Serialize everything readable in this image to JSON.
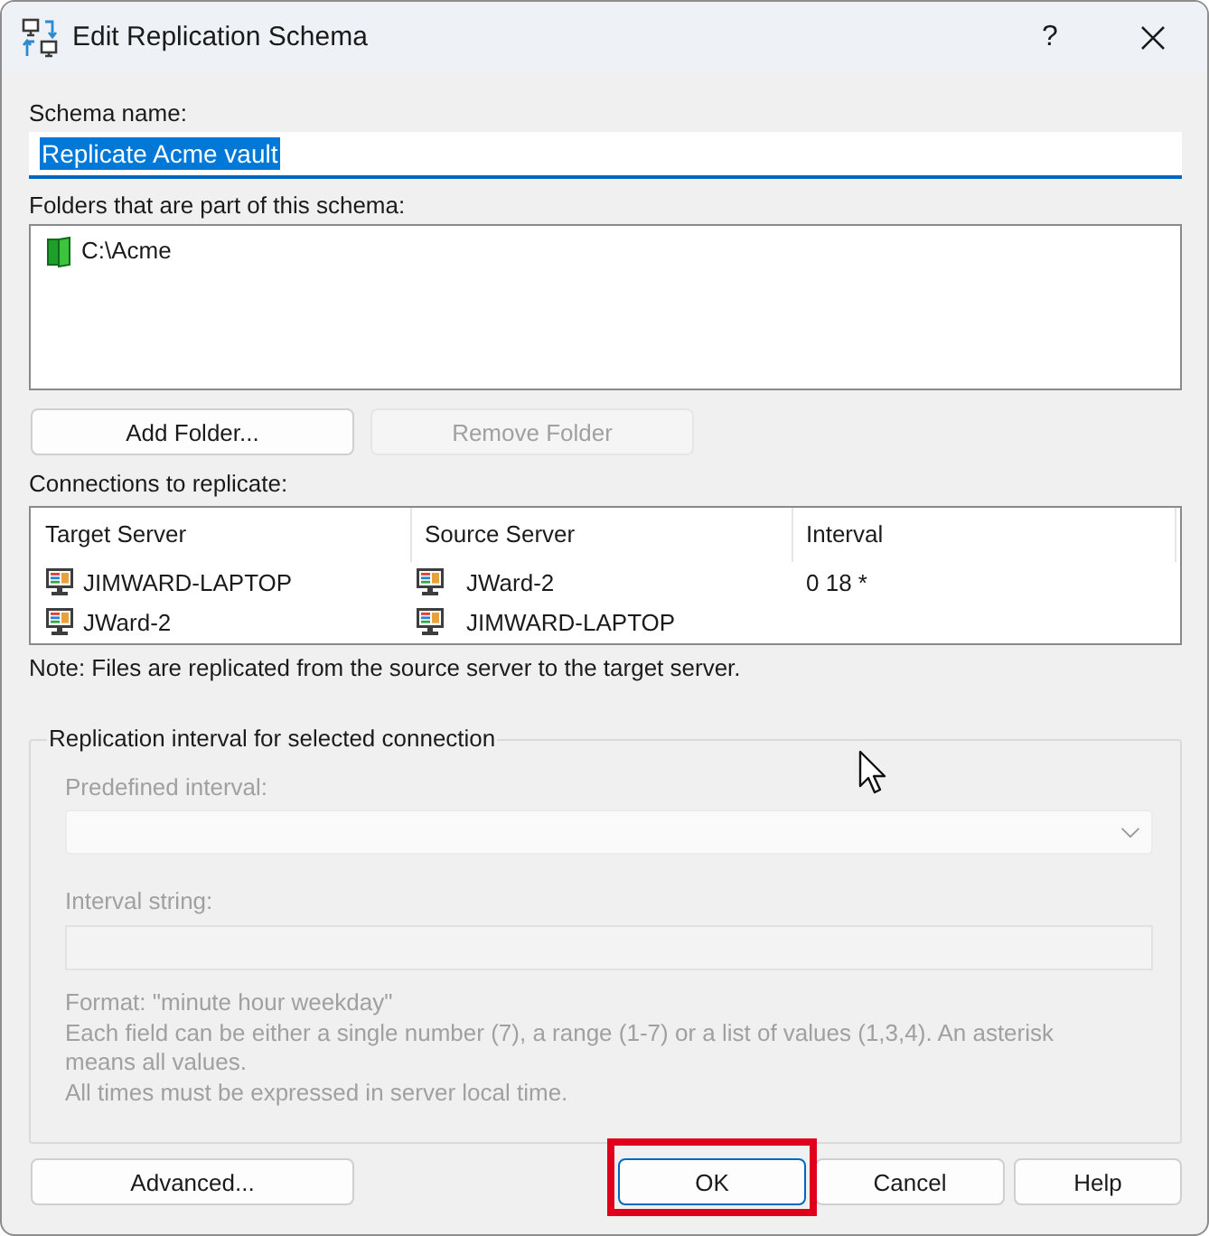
{
  "window": {
    "title": "Edit Replication Schema",
    "help_button": "?"
  },
  "schema_name": {
    "label": "Schema name:",
    "value": "Replicate Acme vault",
    "text_selected": true
  },
  "folders": {
    "label": "Folders that are part of this schema:",
    "items": [
      {
        "path": "C:\\Acme",
        "selected": false
      }
    ]
  },
  "folder_buttons": [
    {
      "label": "Add Folder...",
      "disabled": false
    },
    {
      "label": "Remove Folder",
      "disabled": true
    }
  ],
  "connections": {
    "label": "Connections to replicate:",
    "columns": [
      "Target Server",
      "Source Server",
      "Interval"
    ],
    "rows": [
      {
        "target": "JIMWARD-LAPTOP",
        "source": "JWard-2",
        "interval": "0 18 *",
        "selected": false
      },
      {
        "target": "JWard-2",
        "source": "JIMWARD-LAPTOP",
        "selected": false
      }
    ]
  },
  "note": "Note: Files are replicated from the source server to the target server.",
  "interval_group": {
    "title": "Replication interval for selected connection",
    "disabled": true,
    "predefined_label": "Predefined interval:",
    "interval_label": "Interval string:",
    "help_lines": [
      "Format: \"minute hour weekday\"",
      "Each field can be either a single number (7), a range (1-7) or a list of values (1,3,4). An asterisk means all values.",
      "All times must be expressed in server local time."
    ]
  },
  "advanced_button": {
    "label": "Advanced..."
  },
  "buttons": [
    {
      "label": "OK",
      "default": true,
      "highlighted": true
    },
    {
      "label": "Cancel",
      "default": false,
      "highlighted": false
    },
    {
      "label": "Help",
      "default": false,
      "highlighted": false
    }
  ]
}
